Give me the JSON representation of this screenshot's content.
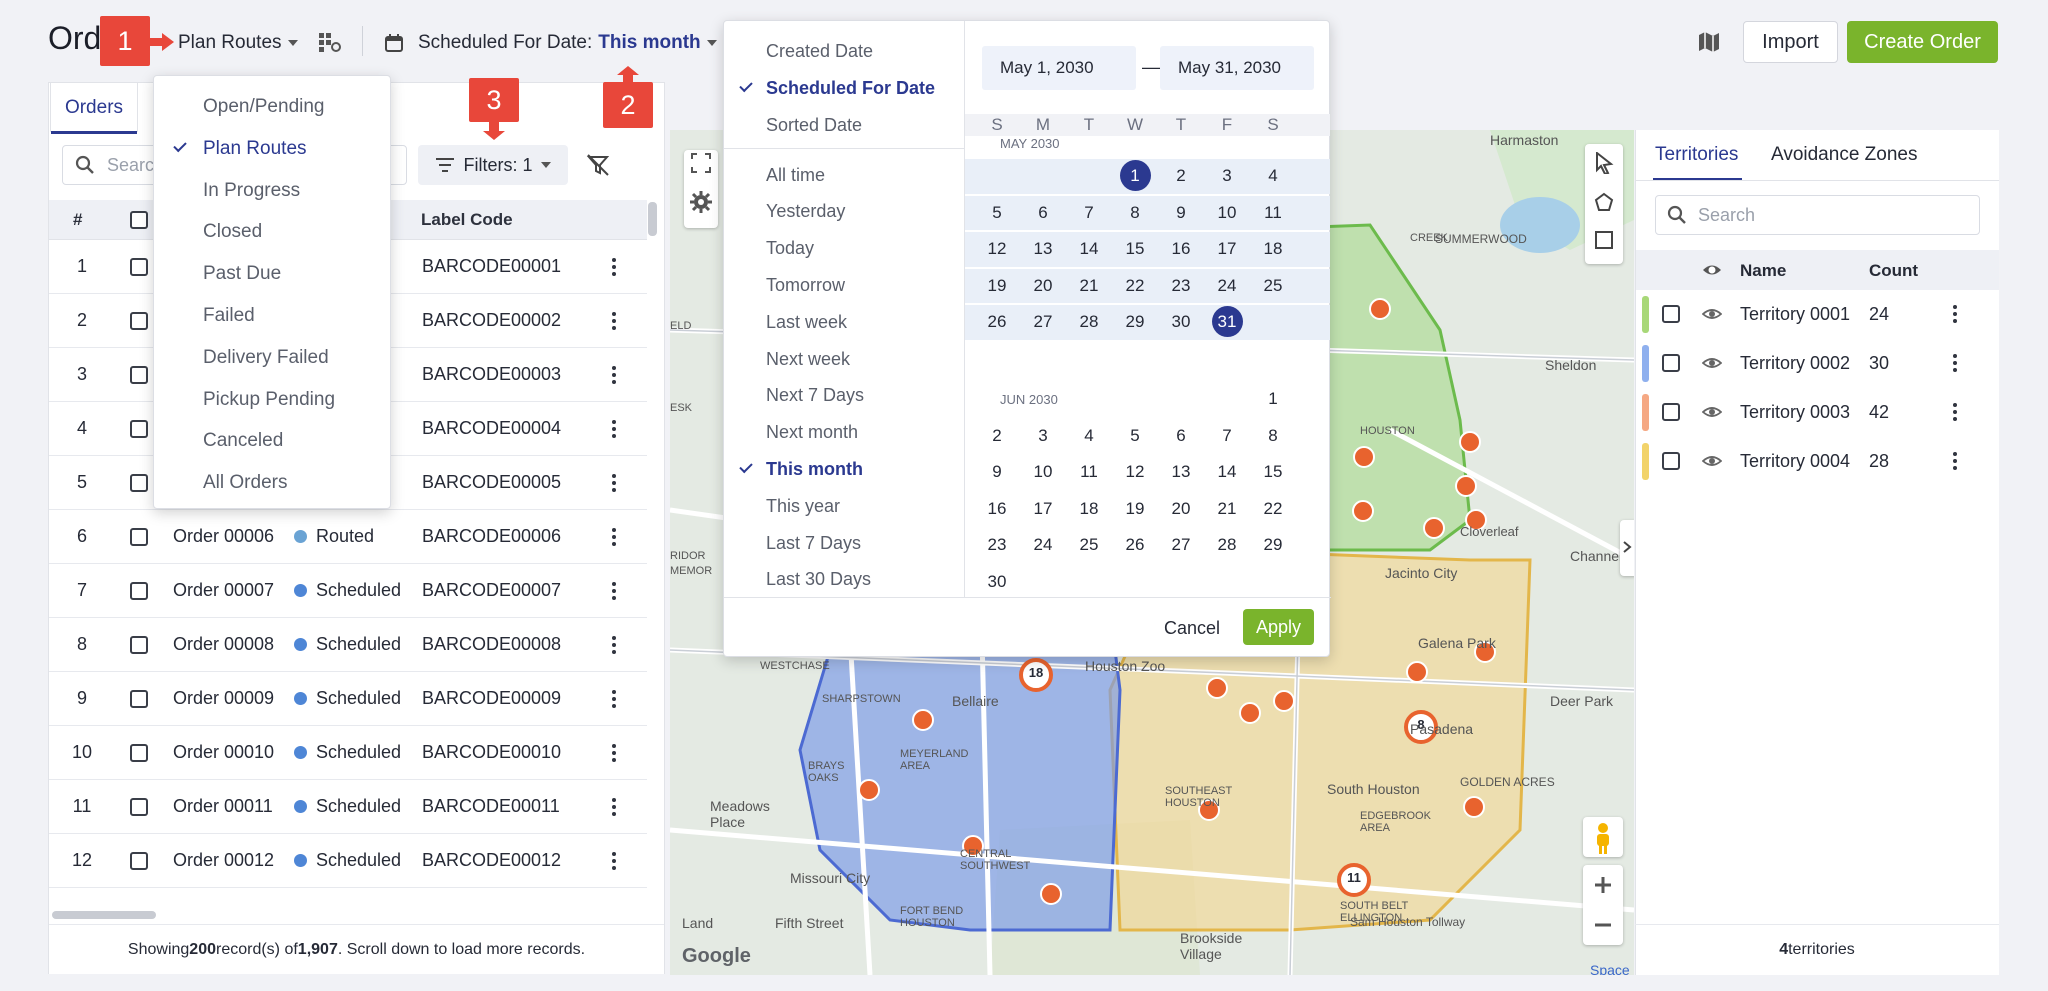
{
  "header": {
    "title": "Ord",
    "plan_routes": "Plan Routes",
    "scheduled_label": "Scheduled For Date:",
    "scheduled_value": "This month",
    "import": "Import",
    "create_order": "Create Order"
  },
  "callouts": [
    "1",
    "2",
    "3"
  ],
  "tabs": {
    "orders": "Orders"
  },
  "toolbar": {
    "search_placeholder": "Search",
    "filters": "Filters: 1"
  },
  "table": {
    "headers": {
      "num": "#",
      "label": "Label Code"
    },
    "rows": [
      {
        "num": "1",
        "name": "",
        "status": "",
        "code": "BARCODE00001"
      },
      {
        "num": "2",
        "name": "",
        "status": "",
        "code": "BARCODE00002"
      },
      {
        "num": "3",
        "name": "",
        "status": "",
        "code": "BARCODE00003"
      },
      {
        "num": "4",
        "name": "",
        "status": "",
        "code": "BARCODE00004"
      },
      {
        "num": "5",
        "name": "",
        "status": "",
        "code": "BARCODE00005"
      },
      {
        "num": "6",
        "name": "Order 00006",
        "status": "Routed",
        "code": "BARCODE00006"
      },
      {
        "num": "7",
        "name": "Order 00007",
        "status": "Scheduled",
        "code": "BARCODE00007"
      },
      {
        "num": "8",
        "name": "Order 00008",
        "status": "Scheduled",
        "code": "BARCODE00008"
      },
      {
        "num": "9",
        "name": "Order 00009",
        "status": "Scheduled",
        "code": "BARCODE00009"
      },
      {
        "num": "10",
        "name": "Order 00010",
        "status": "Scheduled",
        "code": "BARCODE00010"
      },
      {
        "num": "11",
        "name": "Order 00011",
        "status": "Scheduled",
        "code": "BARCODE00011"
      },
      {
        "num": "12",
        "name": "Order 00012",
        "status": "Scheduled",
        "code": "BARCODE00012"
      }
    ]
  },
  "footer": {
    "showing": "Showing ",
    "shown": "200",
    "mid": " record(s) of ",
    "total": "1,907",
    "end": ". Scroll down to load more records."
  },
  "status_menu": {
    "items": [
      "Open/Pending",
      "Plan Routes",
      "In Progress",
      "Closed",
      "Past Due",
      "Failed",
      "Delivery Failed",
      "Pickup Pending",
      "Canceled",
      "All Orders"
    ],
    "selected": "Plan Routes"
  },
  "date_menu": {
    "types": [
      "Created Date",
      "Scheduled For Date",
      "Sorted Date"
    ],
    "selected_type": "Scheduled For Date",
    "ranges": [
      "All time",
      "Yesterday",
      "Today",
      "Tomorrow",
      "Last week",
      "Next week",
      "Next 7 Days",
      "Next month",
      "This month",
      "This year",
      "Last 7 Days",
      "Last 30 Days"
    ],
    "selected_range": "This month",
    "start": "May 1, 2030",
    "dash": "—",
    "end": "May 31, 2030",
    "weekdays": [
      "S",
      "M",
      "T",
      "W",
      "T",
      "F",
      "S"
    ],
    "month1": "MAY 2030",
    "month2": "JUN 2030",
    "cancel": "Cancel",
    "apply": "Apply"
  },
  "map": {
    "labels": [
      "Harmaston",
      "SUMMERWOOD",
      "Sheldon",
      "Cloverleaf",
      "Channelvi",
      "Jacinto City",
      "Galena Park",
      "Deer Park",
      "Pasadena",
      "GOLDEN ACRES",
      "South Houston",
      "EDGEBROOK AREA",
      "SOUTH BELT ELLINGTON",
      "Sam Houston Tollway",
      "Houston Zoo",
      "SOUTHEAST HOUSTON",
      "CENTRAL SOUTHWEST",
      "Bellaire",
      "SHARPSTOWN",
      "MEYERLAND AREA",
      "BRAYS OAKS",
      "Meadows Place",
      "Missouri City",
      "FORT BEND HOUSTON",
      "Fifth Street",
      "Brookside Village",
      "WESTCHASE",
      "Land",
      "CREEK",
      "HOUSTON",
      "ELD",
      "ESK",
      "RIDOR",
      "MEMOR",
      "Space"
    ],
    "clusters": [
      "18",
      "8",
      "11"
    ],
    "google": "Google"
  },
  "territories": {
    "tabs": [
      "Territories",
      "Avoidance Zones"
    ],
    "search_placeholder": "Search",
    "headers": {
      "name": "Name",
      "count": "Count"
    },
    "rows": [
      {
        "name": "Territory 0001",
        "count": "24",
        "color": "#a8d878"
      },
      {
        "name": "Territory 0002",
        "count": "30",
        "color": "#8fb0ee"
      },
      {
        "name": "Territory 0003",
        "count": "42",
        "color": "#f5a883"
      },
      {
        "name": "Territory 0004",
        "count": "28",
        "color": "#f2d36a"
      }
    ],
    "footer_count": "4",
    "footer_label": " territories"
  },
  "colors": {
    "accent": "#2b3990",
    "green": "#7ab42c",
    "callout": "#e8473a",
    "routed": "#6aa3d4",
    "scheduled": "#4e86d6"
  }
}
